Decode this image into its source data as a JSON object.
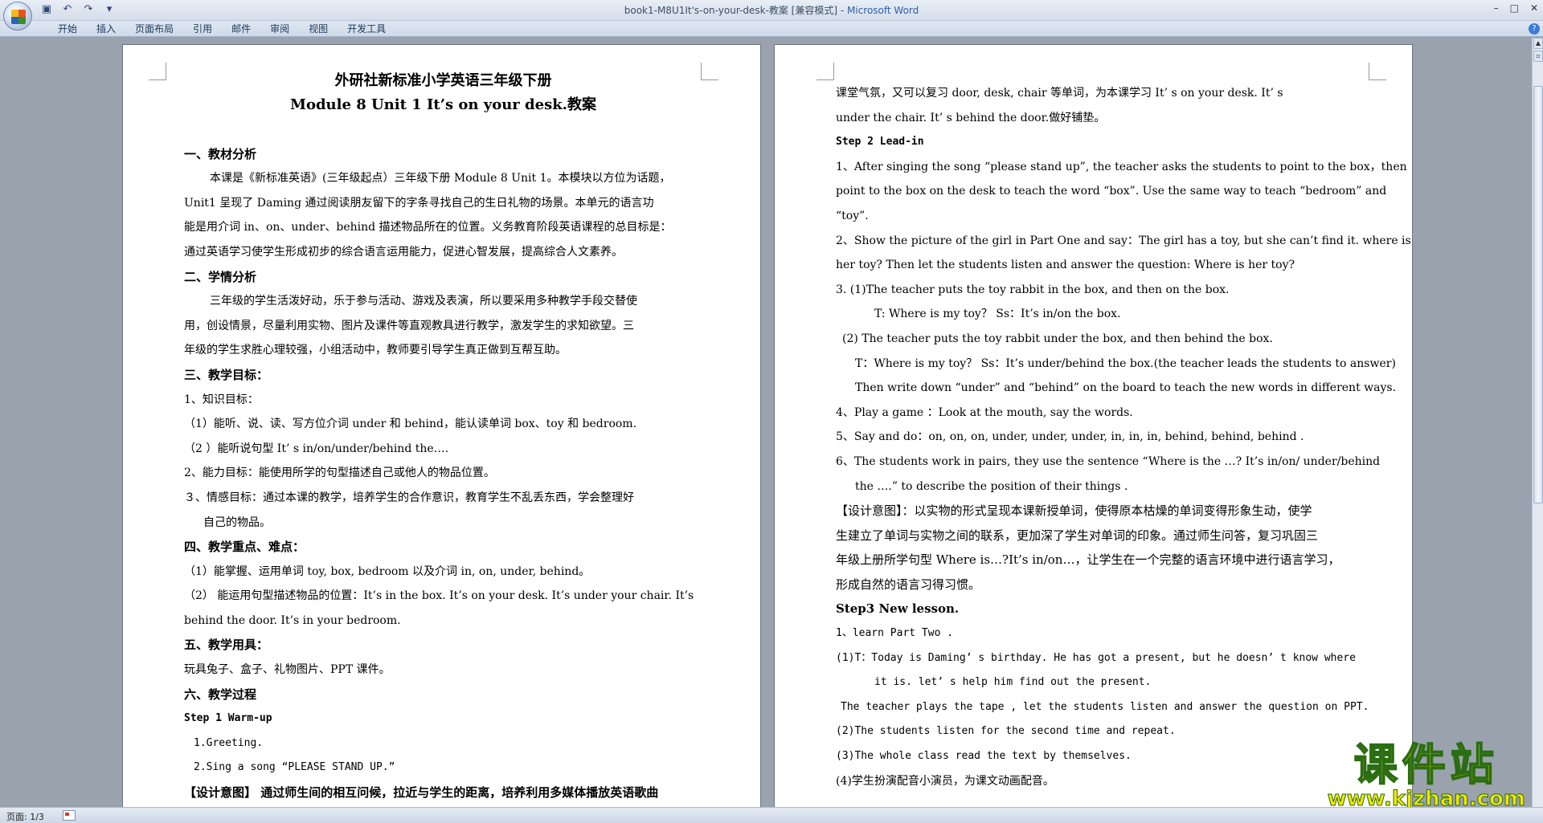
{
  "window": {
    "title": "book1-M8U1It's-on-your-desk-教案 [兼容模式] - ",
    "app_name": "Microsoft Word"
  },
  "quick_access": {
    "save_icon": "save-icon",
    "undo_icon": "undo-icon",
    "redo_icon": "redo-icon",
    "customize": "▾"
  },
  "ribbon": {
    "tabs": [
      "开始",
      "插入",
      "页面布局",
      "引用",
      "邮件",
      "审阅",
      "视图",
      "开发工具"
    ]
  },
  "status_bar": {
    "page": "页面: 1/3"
  },
  "watermark": {
    "text": "课件站",
    "url": "www.kjzhan.com"
  },
  "page1": {
    "title1": "外研社新标准小学英语三年级下册",
    "title2": "Module 8 Unit 1 It’s on your desk.教案",
    "lines": [
      "一、教材分析",
      "本课是《新标准英语》(三年级起点）三年级下册 Module 8 Unit 1。本模块以方位为话题，",
      "Unit1 呈现了 Daming 通过阅读朋友留下的字条寻找自己的生日礼物的场景。本单元的语言功",
      "能是用介词 in、on、under、behind 描述物品所在的位置。义务教育阶段英语课程的总目标是：",
      "通过英语学习使学生形成初步的综合语言运用能力，促进心智发展，提高综合人文素养。",
      "二、学情分析",
      "三年级的学生活泼好动，乐于参与活动、游戏及表演，所以要采用多种教学手段交替使",
      "用，创设情景，尽量利用实物、图片及课件等直观教具进行教学，激发学生的求知欲望。三",
      "年级的学生求胜心理较强，小组活动中，教师要引导学生真正做到互帮互助。",
      "三、教学目标：",
      "1、知识目标：",
      "（1）能听、说、读、写方位介词 under 和 behind，能认读单词 box、toy 和 bedroom.",
      "（2 ）能听说句型 It’ s in/on/under/behind the….",
      "2、能力目标：能使用所学的句型描述自己或他人的物品位置。",
      "３、情感目标：通过本课的教学，培养学生的合作意识，教育学生不乱丢东西，学会整理好",
      "自己的物品。",
      "四、教学重点、难点：",
      "（1）能掌握、运用单词 toy, box, bedroom 以及介词 in, on, under, behind。",
      "（2）  能运用句型描述物品的位置：It’s in the box. It’s on your desk. It’s under your chair. It’s",
      "behind the door. It’s in your bedroom.",
      "五、教学用具：",
      "玩具兔子、盒子、礼物图片、PPT 课件。",
      "六、教学过程",
      "Step 1 Warm-up",
      "1.Greeting.",
      "2.Sing a song “PLEASE STAND UP.”",
      "【设计意图】  通过师生间的相互问候，拉近与学生的距离，培养利用多媒体播放英语歌曲"
    ]
  },
  "page2": {
    "lines": [
      "课堂气氛，又可以复习 door, desk, chair 等单词，为本课学习 It’ s on your desk. It’ s",
      "under the chair. It’ s behind the door.做好铺垫。",
      "Step 2 Lead-in",
      "1、After singing the song “please stand up”, the teacher asks the students to point to the box，then",
      "point to the box on the desk to teach the word “box”. Use the same way to teach “bedroom” and",
      "“toy”.",
      "2、Show the picture of the girl in Part One and say：The girl has a toy, but she can’t find it. where is",
      "her toy? Then let the students listen and answer the question: Where is her toy?",
      "3. (1)The teacher puts the toy rabbit in the box, and then on the box.",
      "T: Where is my toy？     Ss：It’s in/on the box.",
      "(2) The teacher puts the toy rabbit under the box, and then behind the box.",
      "T：Where is my toy？     Ss：It’s under/behind the box.(the teacher leads the students to answer)",
      "Then write down “under” and “behind” on the board to teach the new words in different ways.",
      "4、Play a game ：Look at the mouth, say the words.",
      "5、Say and do：on, on, on, under, under, under, in, in, in, behind, behind, behind .",
      "6、The students work in pairs, they use the sentence “Where is the …? It’s in/on/ under/behind",
      "the ….” to describe the position of their things .",
      "【设计意图】：以实物的形式呈现本课新授单词，使得原本枯燥的单词变得形象生动，使学",
      "生建立了单词与实物之间的联系，更加深了学生对单词的印象。通过师生问答，复习巩固三",
      "年级上册所学句型 Where is…?It’s in/on…，让学生在一个完整的语言环境中进行语言学习，",
      "形成自然的语言习得习惯。",
      "Step3    New lesson.",
      "1、learn Part Two .",
      "(1)T：Today is Daming’ s birthday. He has got a present, but he doesn’ t know where",
      "it is. let’ s help him find out the present.",
      "The teacher plays the tape , let the students listen and answer the question on PPT.",
      "(2)The students listen for the second time and repeat.",
      "(3)The whole class read the text by themselves.",
      "(4)学生扮演配音小演员，为课文动画配音。"
    ]
  }
}
